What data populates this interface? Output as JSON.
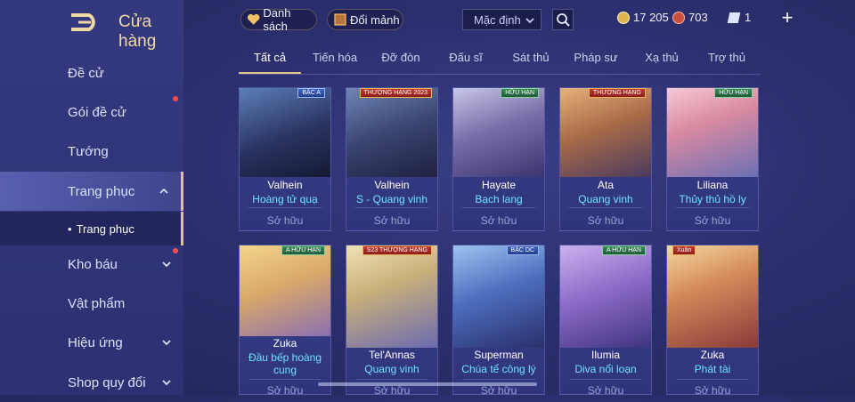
{
  "sidebar": {
    "title": "Cửa hàng",
    "items": [
      {
        "label": "Đề cử"
      },
      {
        "label": "Gói đề cử"
      },
      {
        "label": "Tướng"
      },
      {
        "label": "Trang phục"
      },
      {
        "label": "Kho báu"
      },
      {
        "label": "Vật phẩm"
      },
      {
        "label": "Hiệu ứng"
      },
      {
        "label": "Shop quy đổi"
      }
    ],
    "sub_item": "Trang phục"
  },
  "topbar": {
    "list_label": "Danh sách",
    "exchange_label": "Đổi mảnh",
    "sort_selected": "Mặc định",
    "gold": "17 205",
    "gems": "703",
    "vouchers": "1"
  },
  "tabs": [
    "Tất cả",
    "Tiến hóa",
    "Đỡ đòn",
    "Đấu sĩ",
    "Sát thủ",
    "Pháp sư",
    "Xạ thủ",
    "Trợ thủ"
  ],
  "cards": [
    {
      "hero": "Valhein",
      "skin": "Hoàng tử quạ",
      "status": "Sở hữu",
      "badge": "BẬC A"
    },
    {
      "hero": "Valhein",
      "skin": "S - Quang vinh",
      "status": "Sở hữu",
      "badge": "THƯỢNG HẠNG 2023"
    },
    {
      "hero": "Hayate",
      "skin": "Bạch lang",
      "status": "Sở hữu",
      "badge": "HỮU HẠN"
    },
    {
      "hero": "Ata",
      "skin": "Quang vinh",
      "status": "Sở hữu",
      "badge": "THƯỢNG HẠNG"
    },
    {
      "hero": "Liliana",
      "skin": "Thủy thủ hồ ly",
      "status": "Sở hữu",
      "badge": "HỮU HẠN"
    },
    {
      "hero": "Zuka",
      "skin": "Đầu bếp hoàng cung",
      "status": "Sở hữu",
      "badge": "A HỮU HẠN"
    },
    {
      "hero": "Tel'Annas",
      "skin": "Quang vinh",
      "status": "Sở hữu",
      "badge": "S23 THƯỢNG HẠNG"
    },
    {
      "hero": "Superman",
      "skin": "Chúa tể công lý",
      "status": "Sở hữu",
      "badge": "BẬC DC"
    },
    {
      "hero": "Ilumia",
      "skin": "Diva nổi loạn",
      "status": "Sở hữu",
      "badge": "A HỮU HẠN"
    },
    {
      "hero": "Zuka",
      "skin": "Phát tài",
      "status": "Sở hữu",
      "badge": "Xuân"
    }
  ],
  "colors": {
    "accent": "#e3c48a",
    "skin_text": "#6ee4ff",
    "red_dot": "#ff4d4d"
  }
}
